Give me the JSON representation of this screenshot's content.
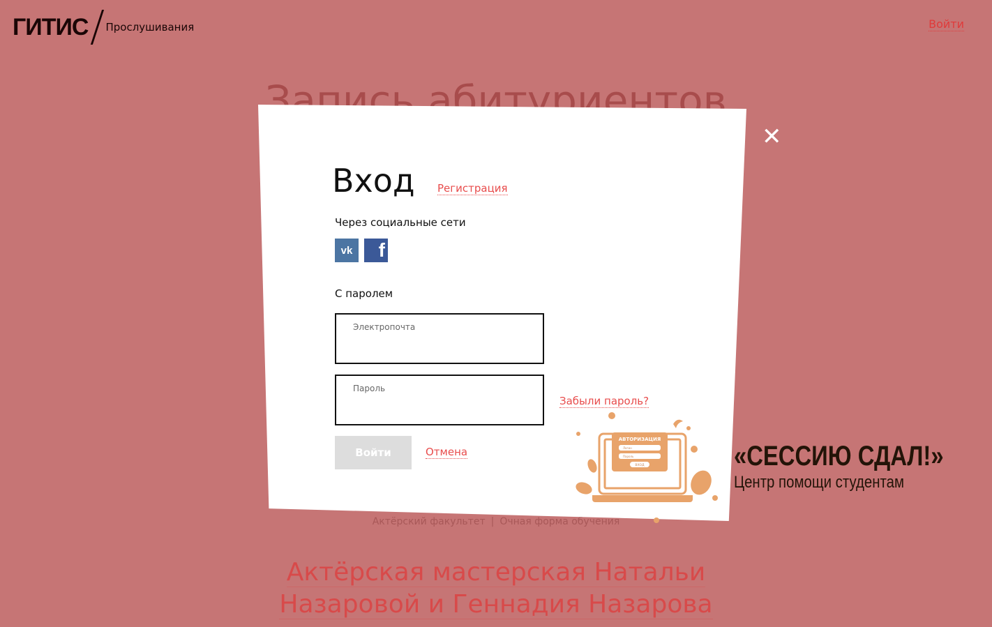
{
  "header": {
    "logo_text": "ГИТИС",
    "subtitle": "Прослушивания",
    "login_link": "Войти"
  },
  "background": {
    "title": "Запись абитуриентов",
    "caption_left": "Актёрский факультет",
    "caption_separator": "|",
    "caption_right": "Очная форма обучения",
    "heading_line1": "Актёрская мастерская Натальи",
    "heading_line2": "Назаровой и Геннадия Назарова"
  },
  "modal": {
    "close_symbol": "✕",
    "title": "Вход",
    "register_link": "Регистрация",
    "social_label": "Через социальные сети",
    "social": {
      "vk_label": "vk",
      "fb_label": "f"
    },
    "password_section_label": "С паролем",
    "email_field": {
      "label": "Электропочта",
      "value": ""
    },
    "password_field": {
      "label": "Пароль",
      "value": ""
    },
    "forgot_link": "Забыли пароль?",
    "login_button": "Войти",
    "cancel_link": "Отмена"
  },
  "promo": {
    "title": "«СЕССИЮ СДАЛ!»",
    "subtitle": "Центр помощи студентам",
    "illustration": {
      "header": "АВТОРИЗАЦИЯ",
      "field1": "Логин",
      "field2": "Пароль",
      "button": "ВХОД"
    }
  },
  "colors": {
    "page_bg": "#c67575",
    "accent": "#e84c4c",
    "vk": "#4c75a3",
    "facebook": "#3b5998",
    "illustration": "#e8a36a"
  }
}
